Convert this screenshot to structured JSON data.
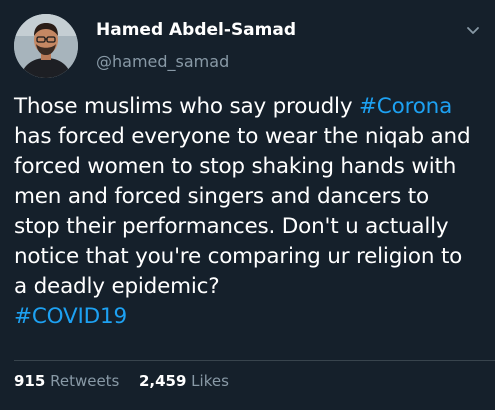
{
  "author": {
    "name": "Hamed Abdel-Samad",
    "handle": "@hamed_samad"
  },
  "tweet": {
    "lines": [
      [
        {
          "text": "Those muslims who say proudly "
        },
        {
          "text": "#Corona",
          "hashtag": true
        }
      ],
      [
        {
          "text": "has forced everyone to wear the niqab and"
        }
      ],
      [
        {
          "text": "forced women to stop shaking hands with"
        }
      ],
      [
        {
          "text": "men and forced singers and dancers to"
        }
      ],
      [
        {
          "text": "stop their performances. Don't u actually"
        }
      ],
      [
        {
          "text": "notice that you're comparing ur religion to"
        }
      ],
      [
        {
          "text": "a deadly epidemic?"
        }
      ],
      [
        {
          "text": "#COVID19",
          "hashtag": true
        }
      ]
    ]
  },
  "stats": {
    "retweets_count": "915",
    "retweets_label": "Retweets",
    "likes_count": "2,459",
    "likes_label": "Likes"
  },
  "icons": {
    "menu": "chevron-down-icon"
  },
  "colors": {
    "background": "#15202b",
    "text": "#ffffff",
    "secondary": "#8899a6",
    "link": "#1da1f2",
    "divider": "#38444d"
  }
}
